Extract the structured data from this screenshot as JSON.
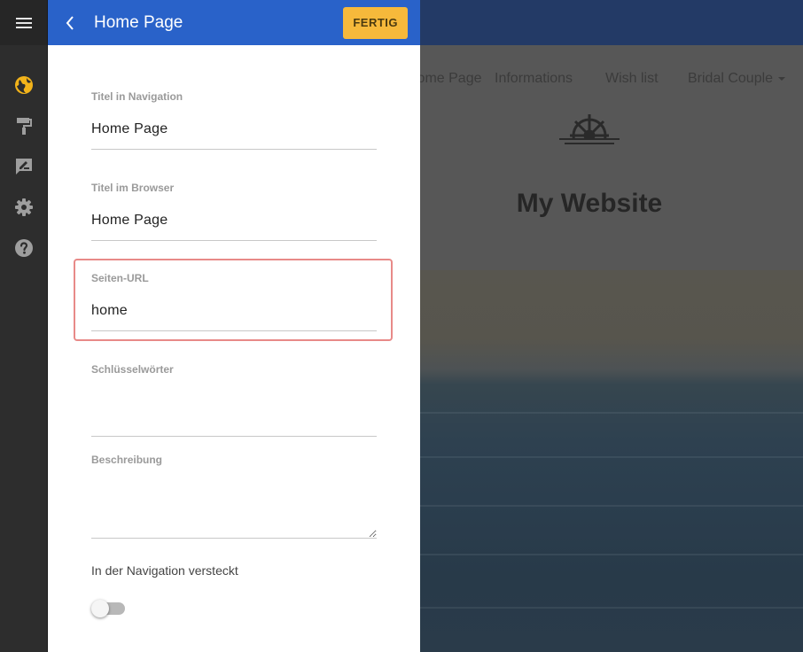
{
  "rail": {
    "menu_icon": "hamburger-menu-icon",
    "items": [
      {
        "icon": "globe-icon",
        "color": "#f2b31a",
        "active": true
      },
      {
        "icon": "paint-roller-icon",
        "color": "#9e9e9e"
      },
      {
        "icon": "edit-note-icon",
        "color": "#9e9e9e"
      },
      {
        "icon": "gear-icon",
        "color": "#9e9e9e"
      },
      {
        "icon": "help-icon",
        "color": "#9e9e9e"
      }
    ]
  },
  "panel": {
    "title": "Home Page",
    "done_label": "FERTIG",
    "header_color": "#2962c9",
    "done_color": "#f6b93b"
  },
  "form": {
    "nav_title": {
      "label": "Titel in Navigation",
      "value": "Home Page"
    },
    "browser_title": {
      "label": "Titel im Browser",
      "value": "Home Page"
    },
    "page_url": {
      "label": "Seiten-URL",
      "value": "home"
    },
    "keywords": {
      "label": "Schlüsselwörter",
      "value": ""
    },
    "description": {
      "label": "Beschreibung",
      "value": ""
    },
    "hidden_toggle": {
      "label": "In der Navigation versteckt",
      "on": false
    }
  },
  "preview": {
    "nav": [
      "Home Page",
      "Informations",
      "Wish list",
      "Bridal Couple"
    ],
    "site_title": "My Website"
  }
}
